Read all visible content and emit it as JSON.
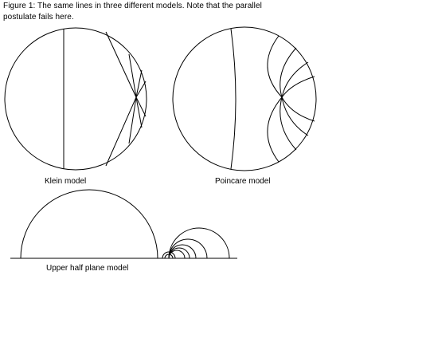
{
  "caption": {
    "line1": "Figure 1: The same lines in three different models. Note that the parallel",
    "line2": "postulate fails here."
  },
  "models": {
    "klein": {
      "label": "Klein model"
    },
    "poincare": {
      "label": "Poincare model"
    },
    "upper_half_plane": {
      "label": "Upper half plane model"
    }
  }
}
